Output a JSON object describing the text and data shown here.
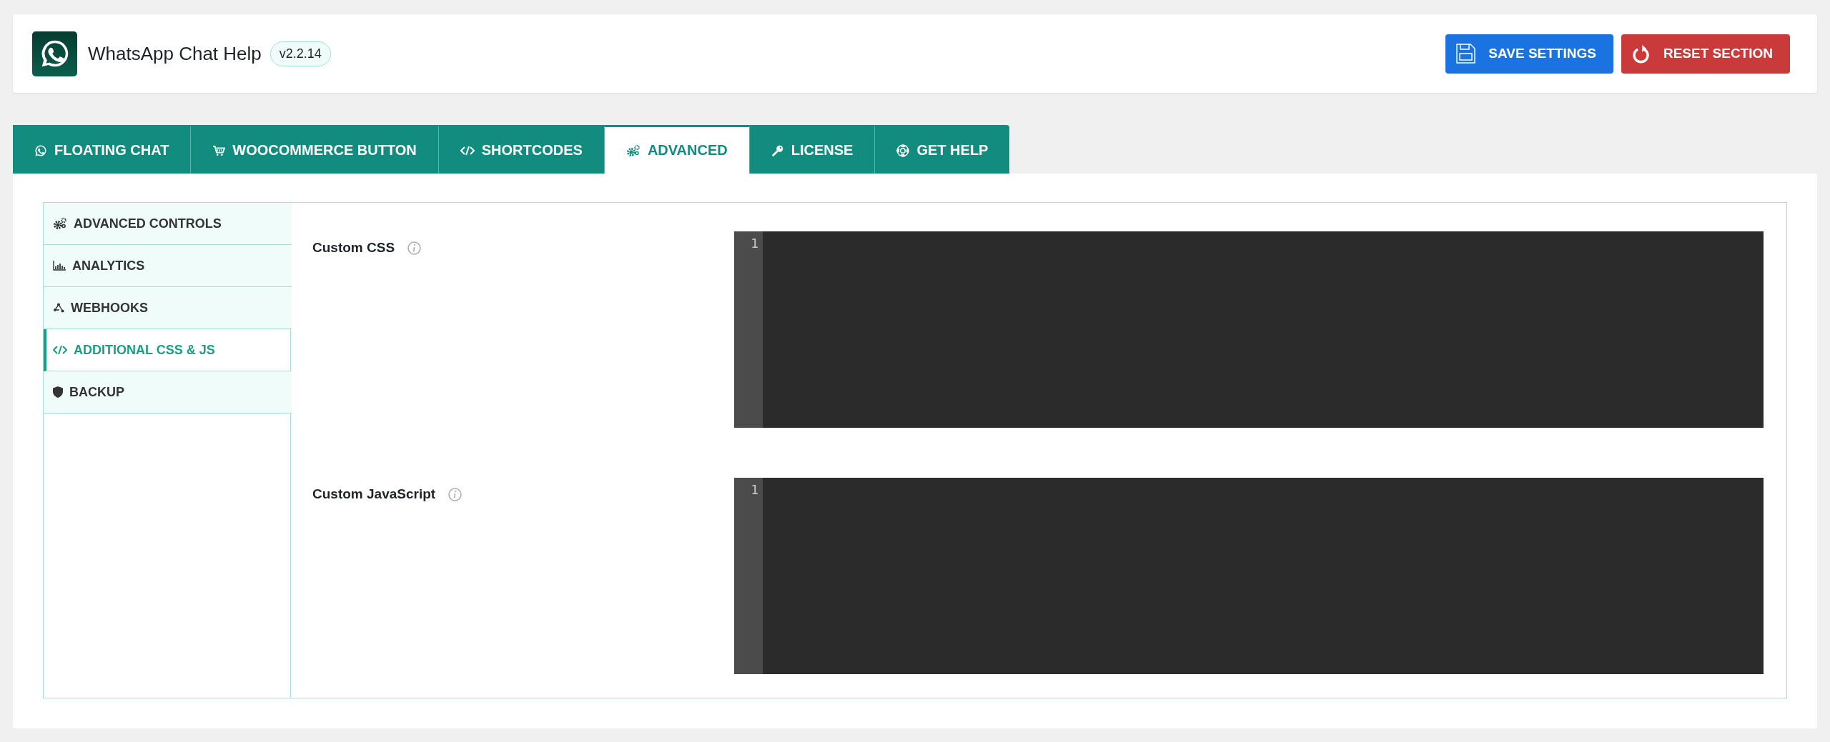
{
  "header": {
    "title": "WhatsApp Chat Help",
    "version": "v2.2.14"
  },
  "buttons": [
    {
      "label": "SAVE SETTINGS",
      "kind": "save"
    },
    {
      "label": "RESET SECTION",
      "kind": "reset"
    }
  ],
  "tabs": [
    {
      "label": "FLOATING CHAT",
      "selected": false
    },
    {
      "label": "WOOCOMMERCE BUTTON",
      "selected": false
    },
    {
      "label": "SHORTCODES",
      "selected": false
    },
    {
      "label": "ADVANCED",
      "selected": true
    },
    {
      "label": "LICENSE",
      "selected": false
    },
    {
      "label": "GET HELP",
      "selected": false
    }
  ],
  "sidebar": {
    "items": [
      {
        "label": "ADVANCED CONTROLS",
        "selected": false
      },
      {
        "label": "ANALYTICS",
        "selected": false
      },
      {
        "label": "WEBHOOKS",
        "selected": false
      },
      {
        "label": "ADDITIONAL CSS & JS",
        "selected": true
      },
      {
        "label": "BACKUP",
        "selected": false
      }
    ]
  },
  "fields": [
    {
      "label": "Custom CSS",
      "line_number": "1"
    },
    {
      "label": "Custom JavaScript",
      "line_number": "1"
    }
  ]
}
